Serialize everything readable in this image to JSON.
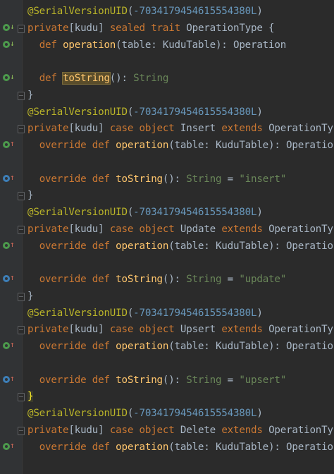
{
  "editor": {
    "lines": [
      {
        "icon": "",
        "fold": false,
        "tokens": [
          [
            "ann",
            "@SerialVersionUID"
          ],
          [
            "plain",
            "("
          ],
          [
            "num",
            "-7034179454615554380L"
          ],
          [
            "plain",
            ")"
          ]
        ]
      },
      {
        "icon": "impl-down",
        "fold": true,
        "tokens": [
          [
            "kw",
            "private"
          ],
          [
            "plain",
            "[kudu] "
          ],
          [
            "kw",
            "sealed trait "
          ],
          [
            "plain",
            "OperationType {"
          ]
        ]
      },
      {
        "icon": "impl-down",
        "fold": false,
        "tokens": [
          [
            "plain",
            "  "
          ],
          [
            "kw",
            "def "
          ],
          [
            "fn",
            "operation"
          ],
          [
            "plain",
            "(table: KuduTable): Operation"
          ]
        ]
      },
      {
        "icon": "",
        "fold": false,
        "tokens": []
      },
      {
        "icon": "impl-down",
        "fold": false,
        "tokens": [
          [
            "plain",
            "  "
          ],
          [
            "kw",
            "def "
          ],
          [
            "fn hl",
            "toString"
          ],
          [
            "plain",
            "(): "
          ],
          [
            "ty2",
            "String"
          ]
        ]
      },
      {
        "icon": "",
        "fold": true,
        "tokens": [
          [
            "plain",
            "}"
          ]
        ]
      },
      {
        "icon": "",
        "fold": false,
        "tokens": [
          [
            "ann",
            "@SerialVersionUID"
          ],
          [
            "plain",
            "("
          ],
          [
            "num",
            "-7034179454615554380L"
          ],
          [
            "plain",
            ")"
          ]
        ]
      },
      {
        "icon": "",
        "fold": true,
        "tokens": [
          [
            "kw",
            "private"
          ],
          [
            "plain",
            "[kudu] "
          ],
          [
            "kw",
            "case object "
          ],
          [
            "plain",
            "Insert "
          ],
          [
            "kw",
            "extends "
          ],
          [
            "plain",
            "OperationTy"
          ]
        ]
      },
      {
        "icon": "impl-up",
        "fold": false,
        "tokens": [
          [
            "plain",
            "  "
          ],
          [
            "kw",
            "override def "
          ],
          [
            "fn",
            "operation"
          ],
          [
            "plain",
            "(table: KuduTable): Operatio"
          ]
        ]
      },
      {
        "icon": "",
        "fold": false,
        "tokens": []
      },
      {
        "icon": "over-up",
        "fold": false,
        "tokens": [
          [
            "plain",
            "  "
          ],
          [
            "kw",
            "override def "
          ],
          [
            "fn",
            "toString"
          ],
          [
            "plain",
            "(): "
          ],
          [
            "ty2",
            "String "
          ],
          [
            "plain",
            "= "
          ],
          [
            "str",
            "\"insert\""
          ]
        ]
      },
      {
        "icon": "",
        "fold": true,
        "tokens": [
          [
            "plain",
            "}"
          ]
        ]
      },
      {
        "icon": "",
        "fold": false,
        "tokens": [
          [
            "ann",
            "@SerialVersionUID"
          ],
          [
            "plain",
            "("
          ],
          [
            "num",
            "-7034179454615554380L"
          ],
          [
            "plain",
            ")"
          ]
        ]
      },
      {
        "icon": "",
        "fold": true,
        "tokens": [
          [
            "kw",
            "private"
          ],
          [
            "plain",
            "[kudu] "
          ],
          [
            "kw",
            "case object "
          ],
          [
            "plain",
            "Update "
          ],
          [
            "kw",
            "extends "
          ],
          [
            "plain",
            "OperationTy"
          ]
        ]
      },
      {
        "icon": "impl-up",
        "fold": false,
        "tokens": [
          [
            "plain",
            "  "
          ],
          [
            "kw",
            "override def "
          ],
          [
            "fn",
            "operation"
          ],
          [
            "plain",
            "(table: KuduTable): Operatio"
          ]
        ]
      },
      {
        "icon": "",
        "fold": false,
        "tokens": []
      },
      {
        "icon": "over-up",
        "fold": false,
        "tokens": [
          [
            "plain",
            "  "
          ],
          [
            "kw",
            "override def "
          ],
          [
            "fn",
            "toString"
          ],
          [
            "plain",
            "(): "
          ],
          [
            "ty2",
            "String "
          ],
          [
            "plain",
            "= "
          ],
          [
            "str",
            "\"update\""
          ]
        ]
      },
      {
        "icon": "",
        "fold": true,
        "tokens": [
          [
            "plain",
            "}"
          ]
        ]
      },
      {
        "icon": "",
        "fold": false,
        "tokens": [
          [
            "ann",
            "@SerialVersionUID"
          ],
          [
            "plain",
            "("
          ],
          [
            "num",
            "-7034179454615554380L"
          ],
          [
            "plain",
            ")"
          ]
        ]
      },
      {
        "icon": "",
        "fold": true,
        "tokens": [
          [
            "kw",
            "private"
          ],
          [
            "plain",
            "[kudu] "
          ],
          [
            "kw",
            "case object "
          ],
          [
            "plain",
            "Upsert "
          ],
          [
            "kw",
            "extends "
          ],
          [
            "plain",
            "OperationTy"
          ]
        ]
      },
      {
        "icon": "impl-up",
        "fold": false,
        "tokens": [
          [
            "plain",
            "  "
          ],
          [
            "kw",
            "override def "
          ],
          [
            "fn",
            "operation"
          ],
          [
            "plain",
            "(table: KuduTable): Operatio"
          ]
        ]
      },
      {
        "icon": "",
        "fold": false,
        "tokens": []
      },
      {
        "icon": "over-up",
        "fold": false,
        "tokens": [
          [
            "plain",
            "  "
          ],
          [
            "kw",
            "override def "
          ],
          [
            "fn",
            "toString"
          ],
          [
            "plain",
            "(): "
          ],
          [
            "ty2",
            "String "
          ],
          [
            "plain",
            "= "
          ],
          [
            "str",
            "\"upsert\""
          ]
        ]
      },
      {
        "icon": "",
        "fold": true,
        "tokens": [
          [
            "plain cur",
            "}"
          ]
        ]
      },
      {
        "icon": "",
        "fold": false,
        "tokens": [
          [
            "ann",
            "@SerialVersionUID"
          ],
          [
            "plain",
            "("
          ],
          [
            "num",
            "-7034179454615554380L"
          ],
          [
            "plain",
            ")"
          ]
        ]
      },
      {
        "icon": "",
        "fold": true,
        "tokens": [
          [
            "kw",
            "private"
          ],
          [
            "plain",
            "[kudu] "
          ],
          [
            "kw",
            "case object "
          ],
          [
            "plain",
            "Delete "
          ],
          [
            "kw",
            "extends "
          ],
          [
            "plain",
            "OperationTy"
          ]
        ]
      },
      {
        "icon": "impl-up",
        "fold": false,
        "tokens": [
          [
            "plain",
            "  "
          ],
          [
            "kw",
            "override def "
          ],
          [
            "fn",
            "operation"
          ],
          [
            "plain",
            "(table: KuduTable): Operatio"
          ]
        ]
      }
    ]
  },
  "colors": {
    "background": "#2b2b2b",
    "gutter": "#313335",
    "annotation": "#bbb529",
    "number": "#6897bb",
    "keyword": "#cc7832",
    "function": "#ffc66d",
    "string": "#6a8759",
    "text": "#a9b7c6"
  },
  "icons": {
    "impl-down": "implementing-method-icon",
    "impl-up": "implemented-method-icon",
    "over-up": "overriding-method-icon"
  }
}
